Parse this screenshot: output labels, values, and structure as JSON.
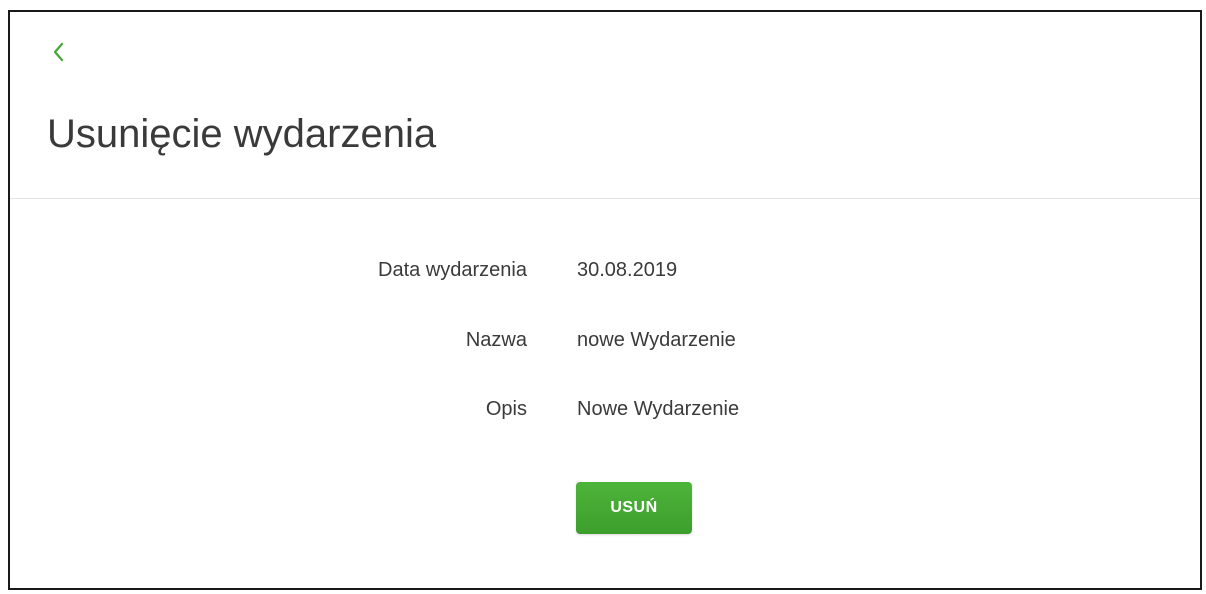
{
  "header": {
    "back_icon": "chevron-left-icon",
    "title": "Usunięcie wydarzenia"
  },
  "details": {
    "date": {
      "label": "Data wydarzenia",
      "value": "30.08.2019"
    },
    "name": {
      "label": "Nazwa",
      "value": "nowe Wydarzenie"
    },
    "description": {
      "label": "Opis",
      "value": "Nowe Wydarzenie"
    }
  },
  "actions": {
    "delete_label": "USUŃ"
  },
  "colors": {
    "accent": "#45a834",
    "text": "#3a3a3a",
    "divider": "#e3e3e3"
  }
}
